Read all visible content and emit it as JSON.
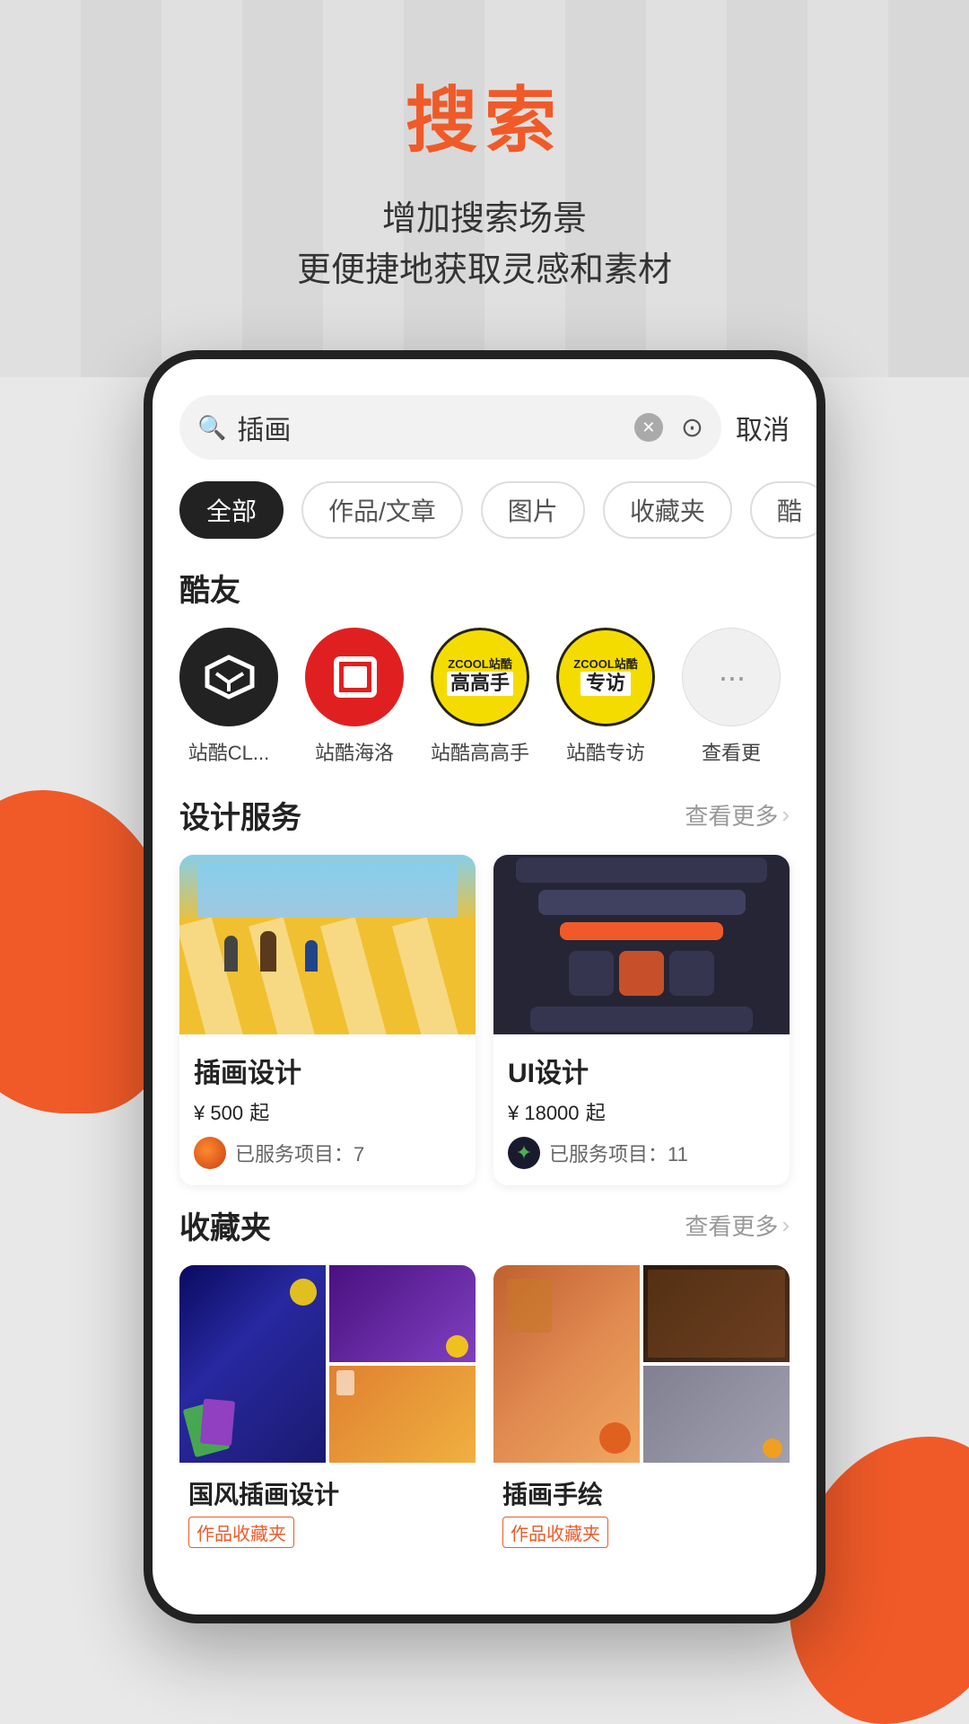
{
  "background": {
    "stripeCount": 12
  },
  "header": {
    "title": "搜索",
    "subtitle_line1": "增加搜索场景",
    "subtitle_line2": "更便捷地获取灵感和素材"
  },
  "search": {
    "placeholder": "插画",
    "cancel_label": "取消"
  },
  "filter_tabs": [
    {
      "id": "all",
      "label": "全部",
      "active": true
    },
    {
      "id": "works",
      "label": "作品/文章",
      "active": false
    },
    {
      "id": "images",
      "label": "图片",
      "active": false
    },
    {
      "id": "folders",
      "label": "收藏夹",
      "active": false
    },
    {
      "id": "more",
      "label": "酷",
      "active": false
    }
  ],
  "friends_section": {
    "title": "酷友",
    "friends": [
      {
        "id": "cl",
        "name": "站酷CL...",
        "type": "envelope"
      },
      {
        "id": "hailuo",
        "name": "站酷海洛",
        "type": "square"
      },
      {
        "id": "gaoshou",
        "name": "站酷高高手",
        "type": "zcool1"
      },
      {
        "id": "zhuanfang",
        "name": "站酷专访",
        "type": "zcool2"
      },
      {
        "id": "more",
        "name": "查看更",
        "type": "dots"
      }
    ]
  },
  "design_service_section": {
    "title": "设计服务",
    "more_label": "查看更多",
    "cards": [
      {
        "id": "illustration",
        "title": "插画设计",
        "price": "¥ 500",
        "price_suffix": "起",
        "meta_label": "已服务项目：7"
      },
      {
        "id": "ui",
        "title": "UI设计",
        "price": "¥ 18000",
        "price_suffix": "起",
        "meta_label": "已服务项目：11"
      }
    ]
  },
  "collections_section": {
    "title": "收藏夹",
    "more_label": "查看更多",
    "collections": [
      {
        "id": "guofeng",
        "name": "国风插画设计",
        "tag": "作品收藏夹"
      },
      {
        "id": "shouhui",
        "name": "插画手绘",
        "tag": "作品收藏夹"
      }
    ]
  },
  "colors": {
    "primary_orange": "#f05a28",
    "black": "#222222",
    "gray_bg": "#f2f2f2",
    "yellow": "#f5dc00"
  }
}
